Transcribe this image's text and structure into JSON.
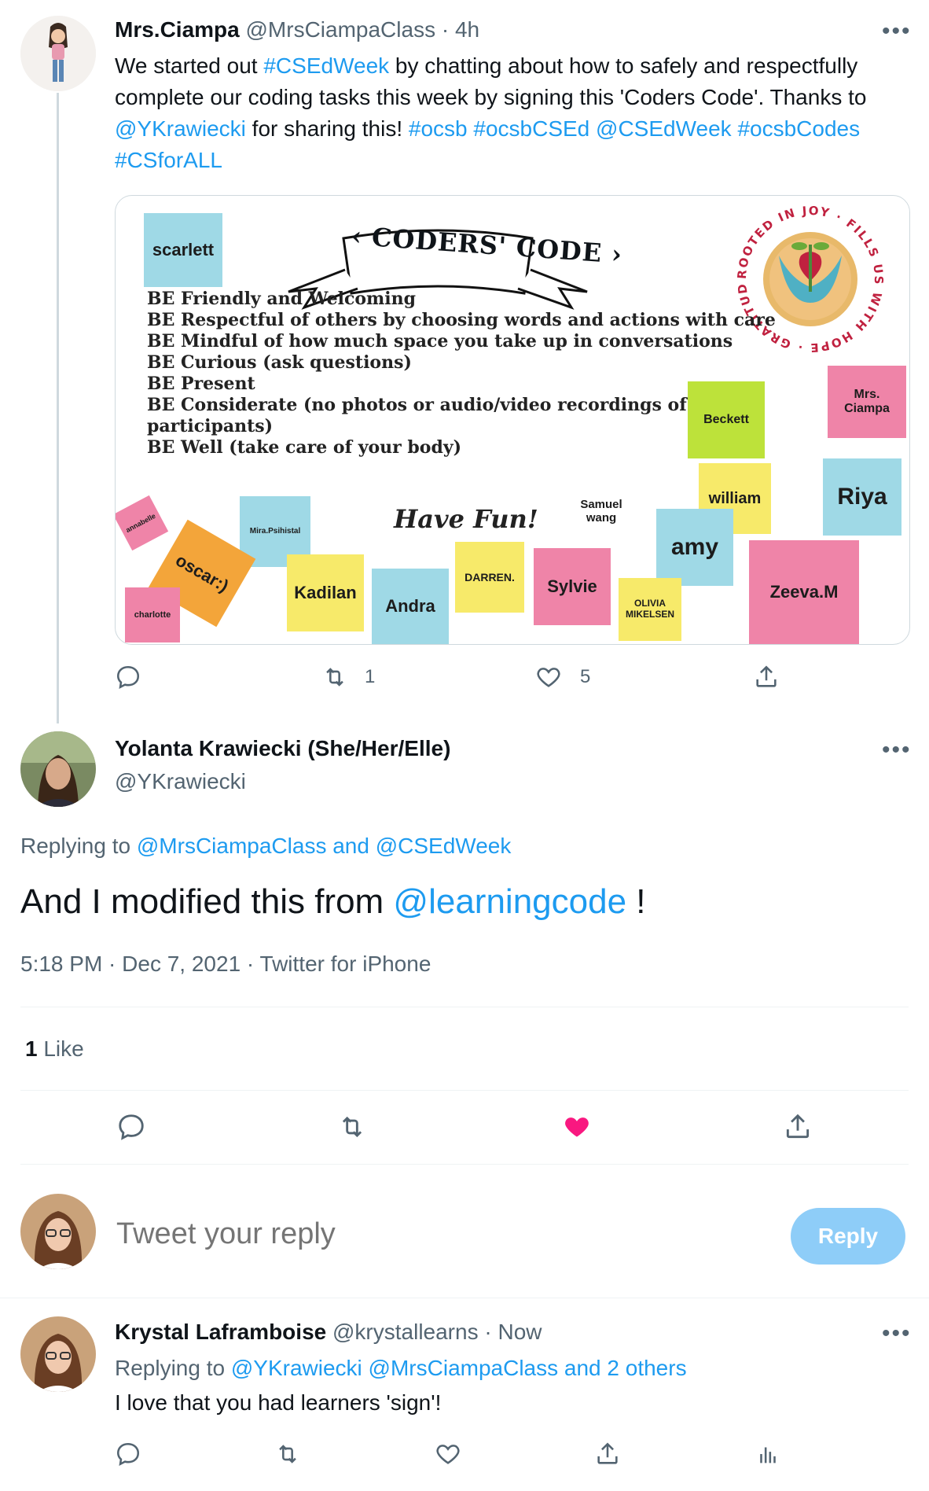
{
  "tweet1": {
    "display_name": "Mrs.Ciampa",
    "handle": "@MrsCiampaClass",
    "time": "· 4h",
    "text_segments": [
      {
        "t": "We started out ",
        "link": false
      },
      {
        "t": "#CSEdWeek",
        "link": true
      },
      {
        "t": " by chatting about how to safely and respectfully complete our coding tasks this week by signing this 'Coders Code'. Thanks to ",
        "link": false
      },
      {
        "t": "@YKrawiecki",
        "link": true
      },
      {
        "t": " for sharing this! ",
        "link": false
      },
      {
        "t": "#ocsb #ocsbCSEd @CSEdWeek #ocsbCodes #CSforALL",
        "link": true
      }
    ],
    "retweets": "1",
    "likes": "5"
  },
  "image": {
    "banner": "‹ CODERS' CODE ›",
    "rules": [
      "BE Friendly and Welcoming",
      "BE Respectful of others by choosing words and actions with care",
      "BE Mindful of how much space you take up in conversations",
      "BE Curious (ask questions)",
      "BE Present",
      "BE Considerate (no photos or audio/video recordings of",
      "participants)",
      "BE Well (take care of your body)"
    ],
    "have_fun": "Have Fun!",
    "logo_text": "ROOTED IN JOY · FILLS US WITH HOPE · GRATITUDE ·",
    "notes": {
      "scarlett": "scarlett",
      "mrs_ciampa": "Mrs. Ciampa",
      "beckett": "Beckett",
      "riya": "Riya",
      "william": "william",
      "samuel": "Samuel wang",
      "amy": "amy",
      "annabelle": "annabelle",
      "mira": "Mira.Psihistal",
      "oscar": "oscar:)",
      "charlotte": "charlotte",
      "kadilan": "Kadilan",
      "andra": "Andra",
      "darren": "DARREN.",
      "sylvie": "Sylvie",
      "olivia": "OLIVIA MIKELSEN",
      "zeeva": "Zeeva.M"
    }
  },
  "tweet2": {
    "display_name": "Yolanta Krawiecki (She/Her/Elle)",
    "handle": "@YKrawiecki",
    "replying_label": "Replying to ",
    "replying_to": "@MrsCiampaClass and @CSEdWeek",
    "text_before": "And I modified this from ",
    "mention": "@learningcode",
    "text_after": " !",
    "meta": "5:18 PM · Dec 7, 2021 · Twitter for iPhone",
    "like_count": "1",
    "like_label": " Like"
  },
  "reply_box": {
    "placeholder": "Tweet your reply",
    "button": "Reply"
  },
  "tweet3": {
    "display_name": "Krystal Laframboise",
    "handle": "@krystallearns",
    "time": "· Now",
    "replying_label": "Replying to ",
    "replying_to": "@YKrawiecki @MrsCiampaClass and 2 others",
    "text": "I love that you had learners 'sign'!"
  },
  "colors": {
    "link": "#1d9bf0",
    "muted": "#536471",
    "liked_heart": "#f91880",
    "reply_button": "#8ecdf8"
  }
}
